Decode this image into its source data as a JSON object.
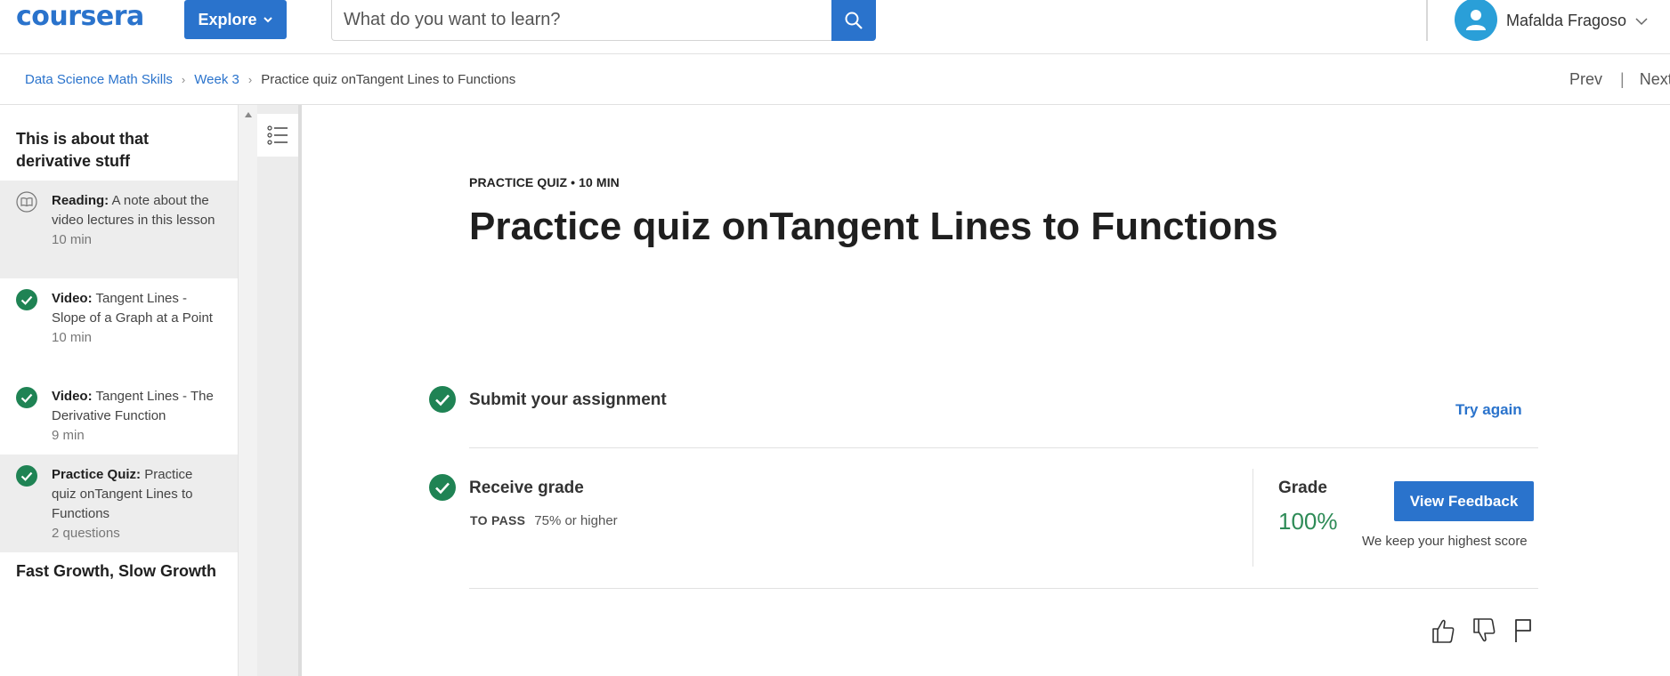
{
  "header": {
    "logo": "coursera",
    "explore_label": "Explore",
    "search_placeholder": "What do you want to learn?",
    "user_name": "Mafalda Fragoso"
  },
  "breadcrumb": {
    "items": [
      "Data Science Math Skills",
      "Week 3",
      "Practice quiz onTangent Lines to Functions"
    ],
    "prev_label": "Prev",
    "separator": "|",
    "next_label": "Next"
  },
  "sidebar": {
    "section_1_title": "This is about that derivative stuff",
    "items": [
      {
        "type": "Reading:",
        "title": "A note about the video lectures in this lesson",
        "duration": "10 min",
        "icon": "book-icon",
        "active": true
      },
      {
        "type": "Video:",
        "title": "Tangent Lines - Slope of a Graph at a Point",
        "duration": "10 min",
        "icon": "check-circle-icon",
        "active": false
      },
      {
        "type": "Video:",
        "title": "Tangent Lines - The Derivative Function",
        "duration": "9 min",
        "icon": "check-circle-icon",
        "active": false
      },
      {
        "type": "Practice Quiz:",
        "title": "Practice quiz onTangent Lines to Functions",
        "duration": "2 questions",
        "icon": "check-circle-icon",
        "active": true
      }
    ],
    "section_2_title": "Fast Growth, Slow Growth"
  },
  "main": {
    "meta": "PRACTICE QUIZ • 10 MIN",
    "title": "Practice quiz onTangent Lines to Functions",
    "submit_label": "Submit your assignment",
    "try_again_label": "Try again",
    "receive_label": "Receive grade",
    "to_pass_key": "TO PASS",
    "to_pass_value": "75% or higher",
    "grade_label": "Grade",
    "grade_value": "100%",
    "view_feedback_label": "View Feedback",
    "keep_note": "We keep your highest score"
  },
  "colors": {
    "brand_blue": "#2a73cc",
    "success_green": "#1f8354",
    "grade_green": "#2e8b57"
  }
}
